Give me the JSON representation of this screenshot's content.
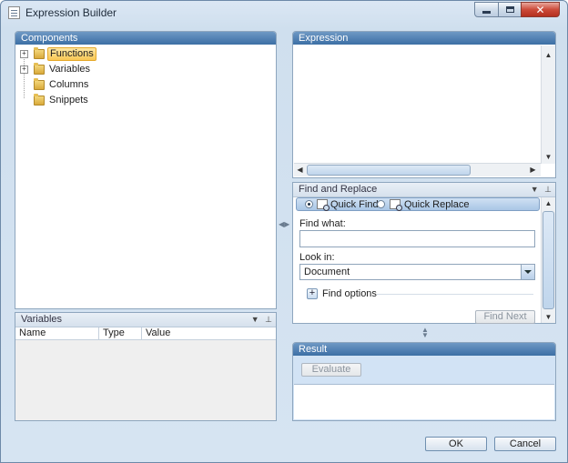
{
  "window": {
    "title": "Expression Builder",
    "controls": {
      "minimize": "minimize-icon",
      "maximize": "maximize-icon",
      "close": "✕"
    }
  },
  "components": {
    "header": "Components",
    "items": [
      {
        "label": "Functions",
        "expandable": true,
        "selected": true
      },
      {
        "label": "Variables",
        "expandable": true,
        "selected": false
      },
      {
        "label": "Columns",
        "expandable": false,
        "selected": false
      },
      {
        "label": "Snippets",
        "expandable": false,
        "selected": false
      }
    ]
  },
  "variables": {
    "header": "Variables",
    "columns": [
      "Name",
      "Type",
      "Value"
    ]
  },
  "expression": {
    "header": "Expression",
    "value": ""
  },
  "find_replace": {
    "header": "Find and Replace",
    "quick_find": "Quick Find",
    "quick_replace": "Quick Replace",
    "find_what_label": "Find what:",
    "find_what_value": "",
    "look_in_label": "Look in:",
    "look_in_value": "Document",
    "find_options": "Find options",
    "find_next": "Find Next"
  },
  "result": {
    "header": "Result",
    "evaluate": "Evaluate",
    "value": ""
  },
  "footer": {
    "ok": "OK",
    "cancel": "Cancel"
  },
  "colors": {
    "header_blue": "#3c6fa5",
    "window_bg": "#d6e4f2",
    "selection": "#f8c754"
  }
}
